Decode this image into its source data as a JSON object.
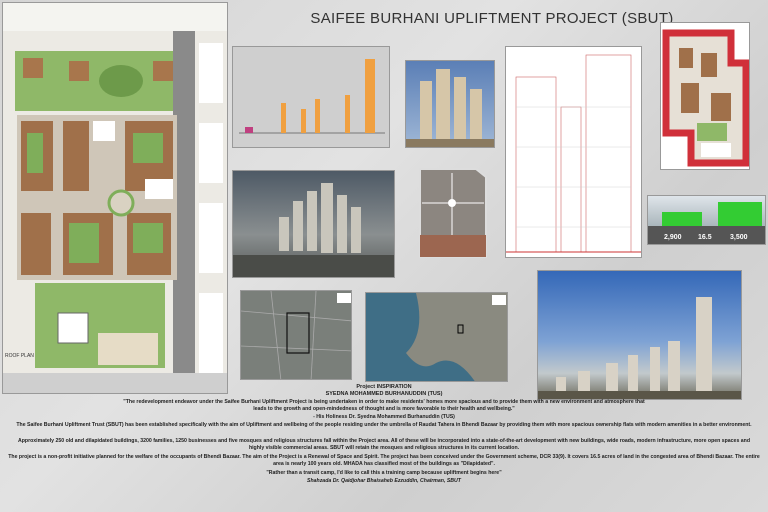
{
  "title": "SAIFEE BURHANI UPLIFTMENT PROJECT (SBUT)",
  "plan_label": "ROOF PLAN",
  "stats": [
    {
      "value": "2,900"
    },
    {
      "value": "16.5"
    },
    {
      "value": "3,500"
    }
  ],
  "text": {
    "heading1": "Project INSPIRATION",
    "heading2": "SYEDNA MOHAMMED BURHANUDDIN (TUS)",
    "quote1": "\"The redevelopment endeavor under the Saifee Burhani Upliftment Project is being undertaken in order to make residents' homes more spacious and to provide them with a new environment and atmosphere that leads to the growth and open-mindedness of thought and is more favorable to their health and wellbeing.\"",
    "attribution1": "- His Holiness Dr. Syedna Mohammed Burhanuddin (TUS)",
    "para1": "The Saifee Burhani Upliftment Trust (SBUT) has been established specifically with the aim of Upliftment and wellbeing of the people residing under the umbrella of Raudat Tahera in Bhendi Bazaar by providing them with more spacious ownership flats with modern amenities in a better environment.",
    "para2": "Approximately 250 old and dilapidated buildings, 3200 families, 1250 businesses and five mosques and religious structures fall within the Project area. All of these will be incorporated into a state-of-the-art development with new buildings, wide roads, modern infrastructure, more open spaces and highly visible commercial areas. SBUT will retain the mosques and religious structures in its current location.",
    "para3": "The project is a non-profit initiative planned for the welfare of the occupants of Bhendi Bazaar. The aim of the Project is a Renewal of Space and Spirit. The project has been conceived under the Government scheme, DCR 33(9). It covers 16.5 acres of land in the congested area of Bhendi Bazaar. The entire area is nearly 100 years old. MHADA has classified most of the buildings as \"Dilapidated\".",
    "quote2": "\"Rather than a transit camp, I'd like to call this a training camp because upliftment begins here\"",
    "attribution2": "Shahzada Dr. Qaidjohar Bhaisaheb Ezzuddin, Chairman, SBUT"
  }
}
